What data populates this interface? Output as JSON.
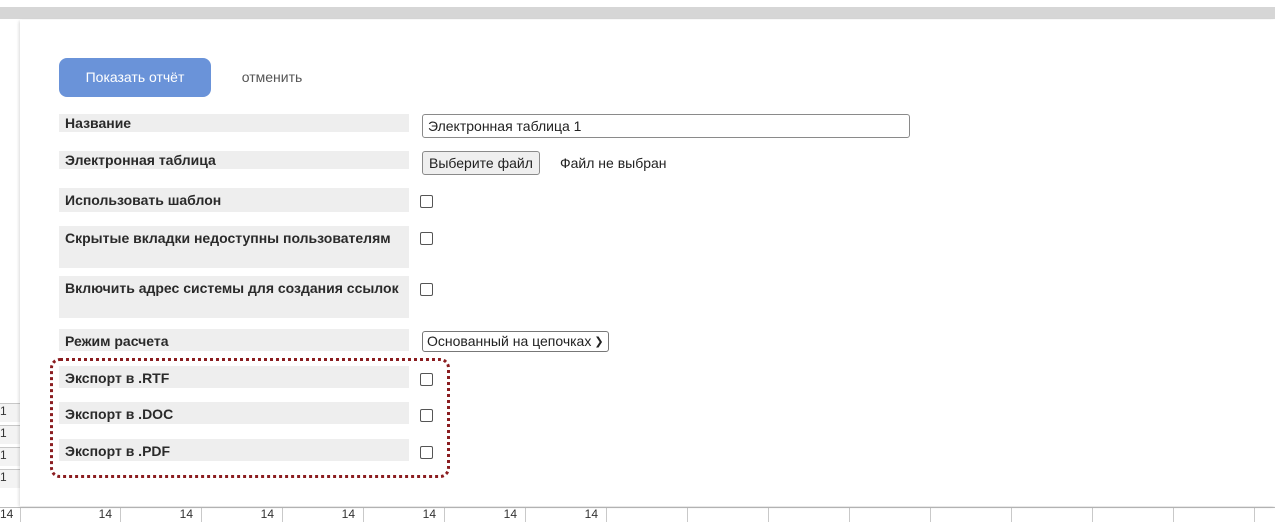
{
  "dialog": {
    "show_report_label": "Показать отчёт",
    "cancel_label": "отменить",
    "fields": {
      "name_label": "Название",
      "name_value": "Электронная таблица 1",
      "spreadsheet_label": "Электронная таблица",
      "choose_file_label": "Выберите файл",
      "file_status": "Файл не выбран",
      "use_template_label": "Использовать шаблон",
      "hidden_tabs_label": "Скрытые вкладки недоступны пользователям",
      "include_address_label": "Включить адрес системы для создания ссылок",
      "calc_mode_label": "Режим расчета",
      "calc_mode_value": "Основанный на цепочках",
      "export_rtf_label": "Экспорт в .RTF",
      "export_doc_label": "Экспорт в .DOC",
      "export_pdf_label": "Экспорт в .PDF"
    }
  },
  "background": {
    "row_numbers": [
      "1",
      "1",
      "1",
      "1"
    ],
    "bottom_row_first": "14",
    "bottom_row_cells": [
      "14",
      "14",
      "14",
      "14",
      "14",
      "14",
      "14"
    ]
  },
  "colors": {
    "primary_button": "#6a93d9",
    "highlight_frame": "#8b1d20",
    "label_background": "#eeeeee"
  }
}
